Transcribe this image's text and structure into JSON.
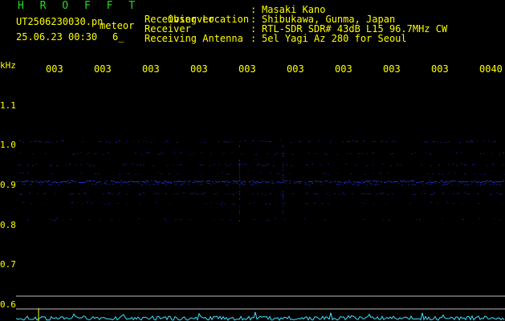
{
  "header": {
    "app_name": "H R O F F T",
    "file_name": "UT2506230030.pn",
    "timestamp": "25.06.23 00:30",
    "count": "6_",
    "mode": "meteor"
  },
  "info": [
    {
      "label": "Observer",
      "sep": ":",
      "value": "Masaki Kano"
    },
    {
      "label": "Receiving Location",
      "sep": ":",
      "value": "Shibukawa, Gunma, Japan"
    },
    {
      "label": "Receiver",
      "sep": ":",
      "value": "RTL-SDR SDR# 43dB L15 96.7MHz CW"
    },
    {
      "label": "Receiving Antenna",
      "sep": ":",
      "value": "5el Yagi Az 280 for Seoul"
    }
  ],
  "axis": {
    "y_unit": "kHz",
    "y_ticks": [
      "1.1",
      "1.0",
      "0.9",
      "0.8",
      "0.7",
      "0.6"
    ],
    "x_ticks": [
      "003",
      "003",
      "003",
      "003",
      "003",
      "003",
      "003",
      "003",
      "003",
      "0040"
    ]
  },
  "colors": {
    "background": "#000000",
    "label_text": "#ffff00",
    "title_text": "#22dd22",
    "signal_blue": "#2a3cff",
    "spectrum_cyan": "#40e0ff",
    "divider_line": "#bbbbbb"
  }
}
